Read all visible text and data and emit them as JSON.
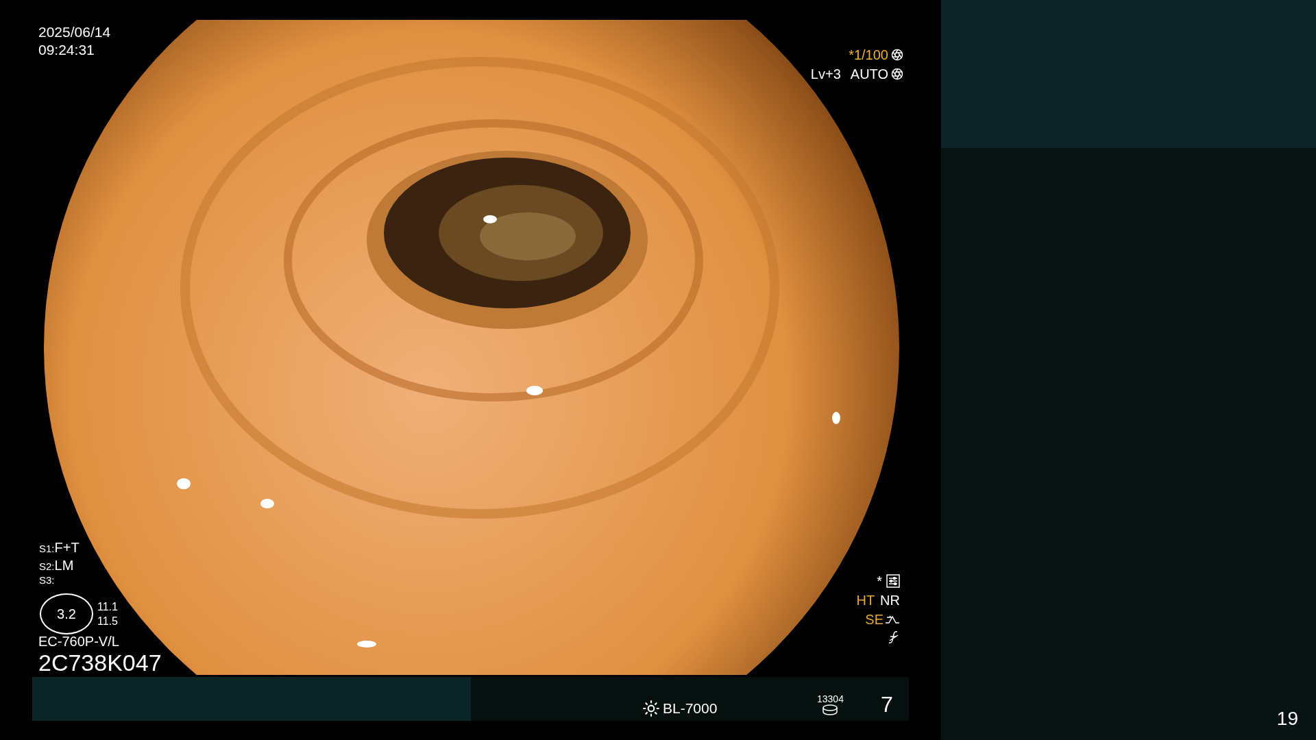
{
  "timestamp": {
    "date": "2025/06/14",
    "time": "09:24:31"
  },
  "exposure": {
    "shutter": "*1/100",
    "level": "Lv+3",
    "mode": "AUTO"
  },
  "switches": [
    {
      "label": "S1:",
      "value": "F+T"
    },
    {
      "label": "S2:",
      "value": "LM"
    },
    {
      "label": "S3:"
    }
  ],
  "gauge": {
    "value": "3.2",
    "readings": [
      "11.1",
      "11.5"
    ]
  },
  "scope": {
    "model": "EC-760P-V/L",
    "serial": "2C738K047"
  },
  "settings": {
    "mark": "*",
    "items": [
      {
        "label": "HT",
        "color": "#e8a838"
      },
      {
        "label": "NR",
        "color": "#ffffff"
      }
    ],
    "enhancement": "SE"
  },
  "status_bar": {
    "light_source": "BL-7000",
    "counter": "13304",
    "number": "7"
  },
  "page": "19"
}
